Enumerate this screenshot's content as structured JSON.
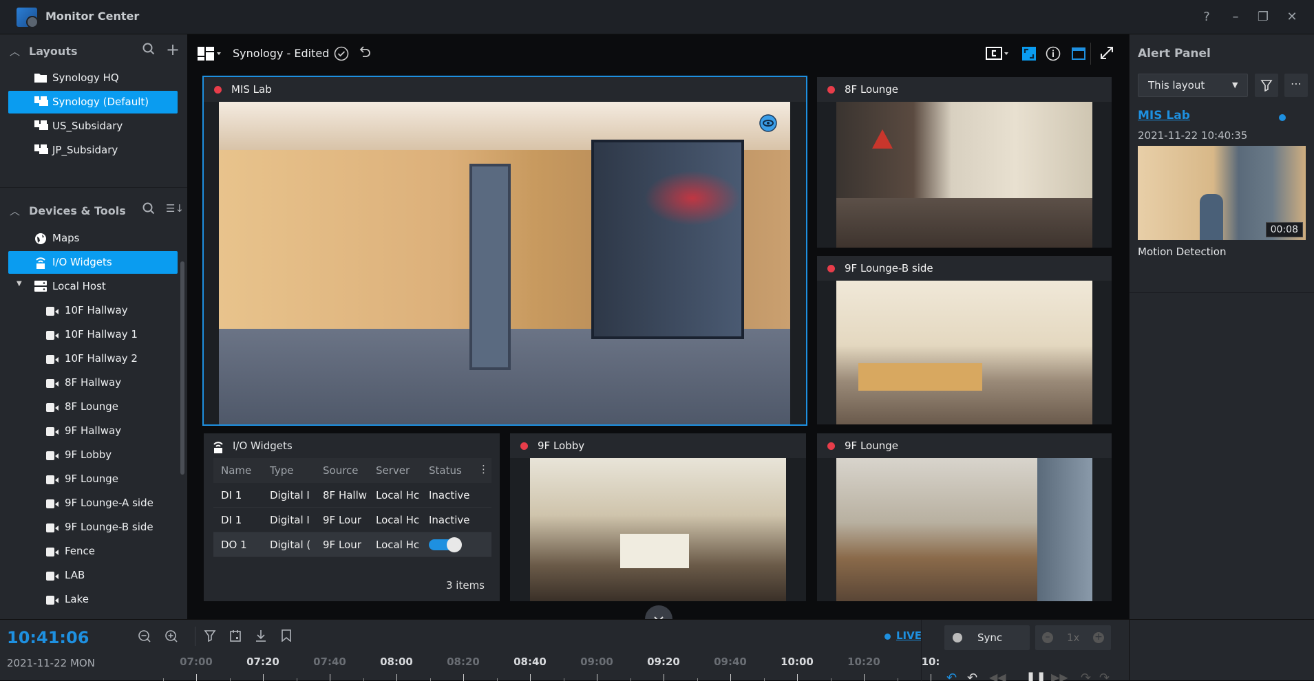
{
  "app": {
    "title": "Monitor Center",
    "window_buttons": {
      "help": "?",
      "minimize": "–",
      "restore": "❐",
      "close": "✕"
    }
  },
  "sidebar": {
    "layouts": {
      "header": "Layouts",
      "search_icon": "⌕",
      "add_icon": "+",
      "items": [
        {
          "label": "Synology HQ",
          "icon": "folder-icon",
          "selected": false
        },
        {
          "label": "Synology (Default)",
          "icon": "layout-icon",
          "selected": true
        },
        {
          "label": "US_Subsidary",
          "icon": "layout-icon",
          "selected": false
        },
        {
          "label": "JP_Subsidary",
          "icon": "layout-icon",
          "selected": false
        }
      ]
    },
    "devices": {
      "header": "Devices & Tools",
      "search_icon": "⌕",
      "sort_icon": "☰↓",
      "tools": [
        {
          "label": "Maps",
          "icon": "globe-icon",
          "selected": false
        },
        {
          "label": "I/O Widgets",
          "icon": "io-widget-icon",
          "selected": true
        }
      ],
      "host": {
        "label": "Local Host",
        "expanded": true
      },
      "cameras": [
        "10F Hallway",
        "10F Hallway 1",
        "10F Hallway 2",
        "8F Hallway",
        "8F Lounge",
        "9F Hallway",
        "9F Lobby",
        "9F Lounge",
        "9F Lounge-A side",
        "9F Lounge-B side",
        "Fence",
        "LAB",
        "Lake"
      ]
    }
  },
  "toolbar": {
    "layout_name": "Synology - Edited",
    "save_icon": "✓",
    "undo_icon": "↶"
  },
  "tiles": [
    {
      "name": "MIS Lab",
      "recording": true,
      "active": true
    },
    {
      "name": "8F Lounge",
      "recording": true
    },
    {
      "name": "9F Lounge-B side",
      "recording": true
    },
    {
      "name": "9F Lobby",
      "recording": true
    },
    {
      "name": "9F Lounge",
      "recording": true
    }
  ],
  "io_widgets": {
    "title": "I/O Widgets",
    "columns": [
      "Name",
      "Type",
      "Source",
      "Server",
      "Status"
    ],
    "rows": [
      {
        "name": "DI 1",
        "type": "Digital I",
        "source": "8F Hallw",
        "server": "Local Hc",
        "status": "Inactive"
      },
      {
        "name": "DI 1",
        "type": "Digital I",
        "source": "9F Lour",
        "server": "Local Hc",
        "status": "Inactive"
      },
      {
        "name": "DO 1",
        "type": "Digital (",
        "source": "9F Lour",
        "server": "Local Hc",
        "status": "toggle-on"
      }
    ],
    "footer": "3 items"
  },
  "alert_panel": {
    "title": "Alert Panel",
    "filter_select": "This layout",
    "alert": {
      "camera": "MIS Lab",
      "timestamp": "2021-11-22 10:40:35",
      "duration": "00:08",
      "event": "Motion Detection",
      "unread": true
    }
  },
  "timeline": {
    "time": "10:41:06",
    "date": "2021-11-22 MON",
    "live_label": "LIVE",
    "sync_label": "Sync",
    "speed_label": "1x",
    "ticks": [
      {
        "label": "07:00",
        "major": false
      },
      {
        "label": "07:20",
        "major": true
      },
      {
        "label": "07:40",
        "major": false
      },
      {
        "label": "08:00",
        "major": true
      },
      {
        "label": "08:20",
        "major": false
      },
      {
        "label": "08:40",
        "major": true
      },
      {
        "label": "09:00",
        "major": false
      },
      {
        "label": "09:20",
        "major": true
      },
      {
        "label": "09:40",
        "major": false
      },
      {
        "label": "10:00",
        "major": true
      },
      {
        "label": "10:20",
        "major": false
      },
      {
        "label": "10:",
        "major": true
      }
    ]
  },
  "colors": {
    "accent": "#0a9cf0",
    "record_dot": "#e83d4a",
    "live": "#1e90e0",
    "panel_bg": "#25282d"
  }
}
